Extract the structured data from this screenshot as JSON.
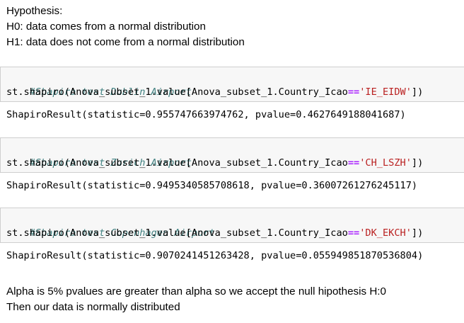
{
  "hypothesis": {
    "title": "Hypothesis:",
    "h0": "H0: data comes from a normal distribution",
    "h1": "H1: data does not come from a normal distribution"
  },
  "cells": [
    {
      "comment": "#Shapiro test Dublin Airport",
      "code_prefix": "st.shapiro(Anova_subset_1.value[Anova_subset_1.Country_Icao",
      "operator": "==",
      "string": "'IE_EIDW'",
      "code_suffix": "])",
      "output": "ShapiroResult(statistic=0.955747663974762, pvalue=0.4627649188041687)"
    },
    {
      "comment": "#Shapiro test Zurich Airport",
      "code_prefix": "st.shapiro(Anova_subset_1.value[Anova_subset_1.Country_Icao",
      "operator": "==",
      "string": "'CH_LSZH'",
      "code_suffix": "])",
      "output": "ShapiroResult(statistic=0.9495340585708618, pvalue=0.36007261276245117)"
    },
    {
      "comment": "#Shapiro test Copenhagen Airport",
      "code_prefix": "st.shapiro(Anova_subset_1.value[Anova_subset_1.Country_Icao",
      "operator": "==",
      "string": "'DK_EKCH'",
      "code_suffix": "])",
      "output": "ShapiroResult(statistic=0.9070241451263428, pvalue=0.055949851870536804)"
    }
  ],
  "conclusion": {
    "line1": "Alpha is 5% pvalues are greater than alpha so we accept the null hipothesis H:0",
    "line2": "Then our data is normally distributed"
  },
  "colors": {
    "comment": "#408080",
    "operator": "#aa22ff",
    "string": "#ba2121",
    "cell_background": "#f7f7f7",
    "cell_border": "#cfcfcf"
  }
}
